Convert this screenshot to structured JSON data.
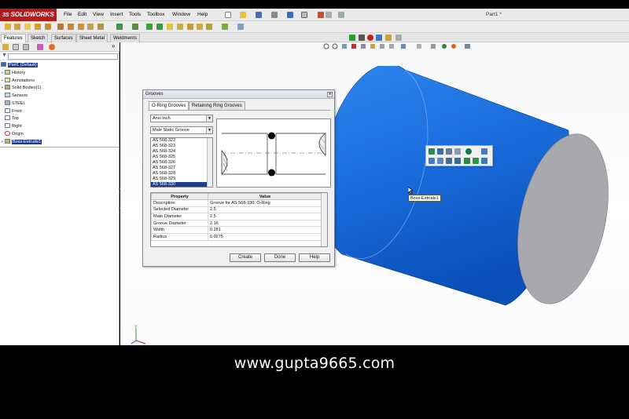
{
  "app": {
    "brand": "SOLIDWORKS",
    "brand_prefix": "3S",
    "document_title": "Part1 *",
    "menu": [
      "File",
      "Edit",
      "View",
      "Insert",
      "Tools",
      "Toolbox",
      "Window",
      "Help"
    ]
  },
  "feature_tabs": [
    {
      "label": "Features",
      "active": true
    },
    {
      "label": "Sketch",
      "active": false
    },
    {
      "label": "Surfaces",
      "active": false
    },
    {
      "label": "Sheet Metal",
      "active": false
    },
    {
      "label": "Weldments",
      "active": false
    }
  ],
  "feature_tree": {
    "root": "Part1 (Default)",
    "items": [
      {
        "label": "History",
        "icon": "history-icon",
        "expandable": true
      },
      {
        "label": "Annotations",
        "icon": "annotations-icon",
        "expandable": true
      },
      {
        "label": "Solid Bodies(1)",
        "icon": "solid-bodies-icon",
        "expandable": true
      },
      {
        "label": "Sensors",
        "icon": "sensors-icon",
        "expandable": false
      },
      {
        "label": "STEEL",
        "icon": "material-icon",
        "expandable": false
      },
      {
        "label": "Front",
        "icon": "plane-icon",
        "expandable": false
      },
      {
        "label": "Top",
        "icon": "plane-icon",
        "expandable": false
      },
      {
        "label": "Right",
        "icon": "plane-icon",
        "expandable": false
      },
      {
        "label": "Origin",
        "icon": "origin-icon",
        "expandable": false
      },
      {
        "label": "Boss-Extrude1",
        "icon": "extrude-icon",
        "expandable": true,
        "selected": true
      }
    ]
  },
  "dialog": {
    "title": "Grooves",
    "close": "×",
    "tabs": [
      {
        "label": "O-Ring Grooves",
        "active": true
      },
      {
        "label": "Retaining Ring Grooves",
        "active": false
      }
    ],
    "standard": "Ansi Inch",
    "groove_type": "Male Static Groove",
    "sizes": [
      "AS 568-322",
      "AS 568-323",
      "AS 568-324",
      "AS 568-325",
      "AS 568-326",
      "AS 568-327",
      "AS 568-328",
      "AS 568-329",
      "AS 568-330"
    ],
    "selected_size": "AS 568-330",
    "table": {
      "headers": [
        "Property",
        "Value"
      ],
      "rows": [
        [
          "Description",
          "Groove for AS 568-330, O-Ring"
        ],
        [
          "Selected Diameter",
          "2.5"
        ],
        [
          "Mate Diameter",
          "2.5"
        ],
        [
          "Groove Diameter",
          "2.16"
        ],
        [
          "Width",
          "0.281"
        ],
        [
          "Radius",
          "0.0275"
        ]
      ]
    },
    "buttons": [
      "Create",
      "Done",
      "Help"
    ]
  },
  "viewport": {
    "tooltip": "Boss-Extrude1",
    "body_color": "#1e6fd9",
    "face_color": "#a6a8ae"
  },
  "footer": {
    "website": "www.gupta9665.com"
  }
}
